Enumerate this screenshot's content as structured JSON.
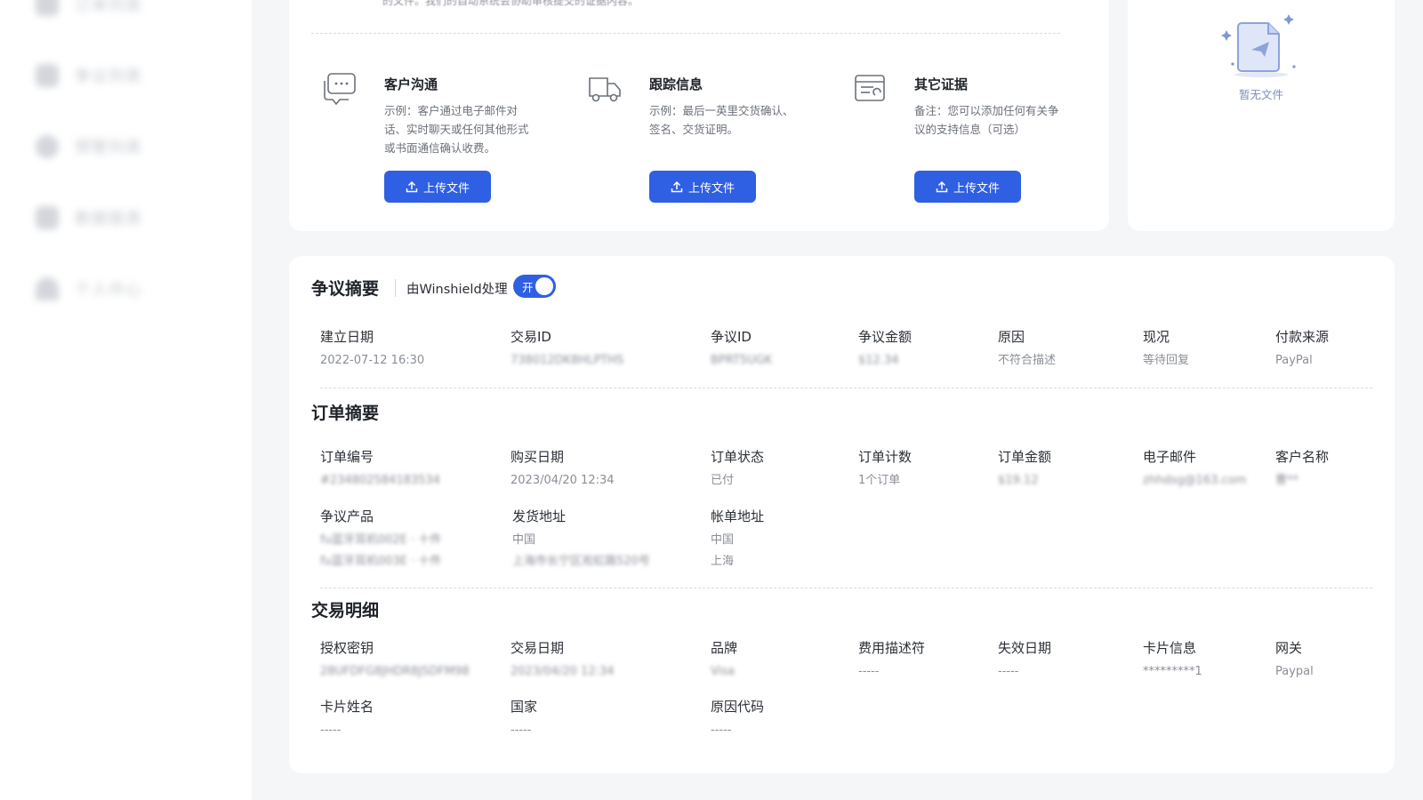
{
  "sidebar": {
    "items": [
      {
        "icon": "menu-icon",
        "label": "订单列表"
      },
      {
        "icon": "document-icon",
        "label": "争议列表"
      },
      {
        "icon": "shield-icon",
        "label": "预警列表"
      },
      {
        "icon": "chart-icon",
        "label": "数据报表"
      },
      {
        "icon": "user-icon",
        "label": "个人中心"
      }
    ]
  },
  "evidence": {
    "top_text": "的文件。我们的自动系统会协助审核提交的证据内容。",
    "items": [
      {
        "icon": "chat-icon",
        "title": "客户沟通",
        "desc": "示例：客户通过电子邮件对话、实时聊天或任何其他形式或书面通信确认收费。",
        "button": "上传文件"
      },
      {
        "icon": "truck-icon",
        "title": "跟踪信息",
        "desc": "示例：最后一英里交货确认、签名、交货证明。",
        "button": "上传文件"
      },
      {
        "icon": "receipt-icon",
        "title": "其它证据",
        "desc": "备注：您可以添加任何有关争议的支持信息（可选）",
        "button": "上传文件"
      }
    ]
  },
  "files": {
    "empty_text": "暂无文件"
  },
  "dispute_summary": {
    "title": "争议摘要",
    "handled_label": "由Winshield处理",
    "toggle_label": "开",
    "fields": [
      {
        "label": "建立日期",
        "value": "2022-07-12 16:30"
      },
      {
        "label": "交易ID",
        "value": "738012DK8HLPTHS"
      },
      {
        "label": "争议ID",
        "value": "BPRT5UGK"
      },
      {
        "label": "争议金额",
        "value": "$12.34"
      },
      {
        "label": "原因",
        "value": "不符合描述"
      },
      {
        "label": "现况",
        "value": "等待回复"
      },
      {
        "label": "付款来源",
        "value": "PayPal"
      }
    ]
  },
  "order_summary": {
    "title": "订单摘要",
    "row1": [
      {
        "label": "订单编号",
        "value": "#234802584183534"
      },
      {
        "label": "购买日期",
        "value": "2023/04/20 12:34"
      },
      {
        "label": "订单状态",
        "value": "已付"
      },
      {
        "label": "订单计数",
        "value": "1个订单"
      },
      {
        "label": "订单金额",
        "value": "$19.12"
      },
      {
        "label": "电子邮件",
        "value": "zhhdsg@163.com"
      },
      {
        "label": "客户名称",
        "value": "曹**"
      }
    ],
    "row2": [
      {
        "label": "争议产品",
        "value1": "fu蓝牙耳机002E · 十件",
        "value2": "fu蓝牙耳机003E · 十件"
      },
      {
        "label": "发货地址",
        "value1": "中国",
        "value2": "上海市长宁区淞虹路520号"
      },
      {
        "label": "帐单地址",
        "value1": "中国",
        "value2": "上海"
      }
    ]
  },
  "transaction": {
    "title": "交易明细",
    "row1": [
      {
        "label": "授权密钥",
        "value": "28UFDFG8JHDR8JSDFM98"
      },
      {
        "label": "交易日期",
        "value": "2023/04/20 12:34"
      },
      {
        "label": "品牌",
        "value": "Visa"
      },
      {
        "label": "费用描述符",
        "value": "-----"
      },
      {
        "label": "失效日期",
        "value": "-----"
      },
      {
        "label": "卡片信息",
        "value": "*********1"
      },
      {
        "label": "网关",
        "value": "Paypal"
      }
    ],
    "row2": [
      {
        "label": "卡片姓名",
        "value": "-----"
      },
      {
        "label": "国家",
        "value": "-----"
      },
      {
        "label": "原因代码",
        "value": "-----"
      }
    ]
  }
}
